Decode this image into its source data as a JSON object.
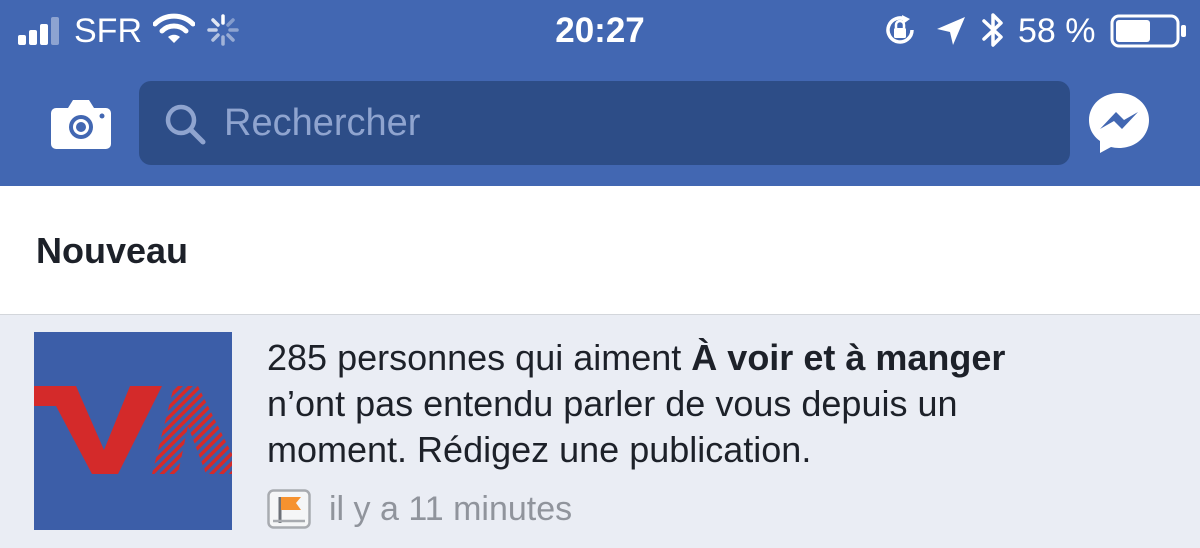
{
  "status_bar": {
    "carrier": "SFR",
    "time": "20:27",
    "battery_percent": "58 %",
    "battery_level": 0.58,
    "signal_bars": 3,
    "icons": [
      "signal-icon",
      "wifi-icon",
      "activity-spinner-icon",
      "rotation-lock-icon",
      "location-arrow-icon",
      "bluetooth-icon",
      "battery-icon"
    ]
  },
  "top_bar": {
    "search_placeholder": "Rechercher",
    "icons": [
      "camera-icon",
      "search-icon",
      "messenger-icon"
    ]
  },
  "section": {
    "title": "Nouveau"
  },
  "notification": {
    "count_prefix": "285 personnes qui aiment ",
    "page_name": "À voir et à manger",
    "line2": "n’ont pas entendu parler de vous depuis un",
    "line3": "moment. Rédigez une publication.",
    "time_ago": "il y a 11 minutes",
    "icons": [
      "page-logo",
      "page-flag-icon"
    ]
  },
  "colors": {
    "header_blue": "#4267b2",
    "search_field": "#2d4d87",
    "notification_unread_bg": "#eaedf4",
    "logo_red": "#d42a2a"
  }
}
